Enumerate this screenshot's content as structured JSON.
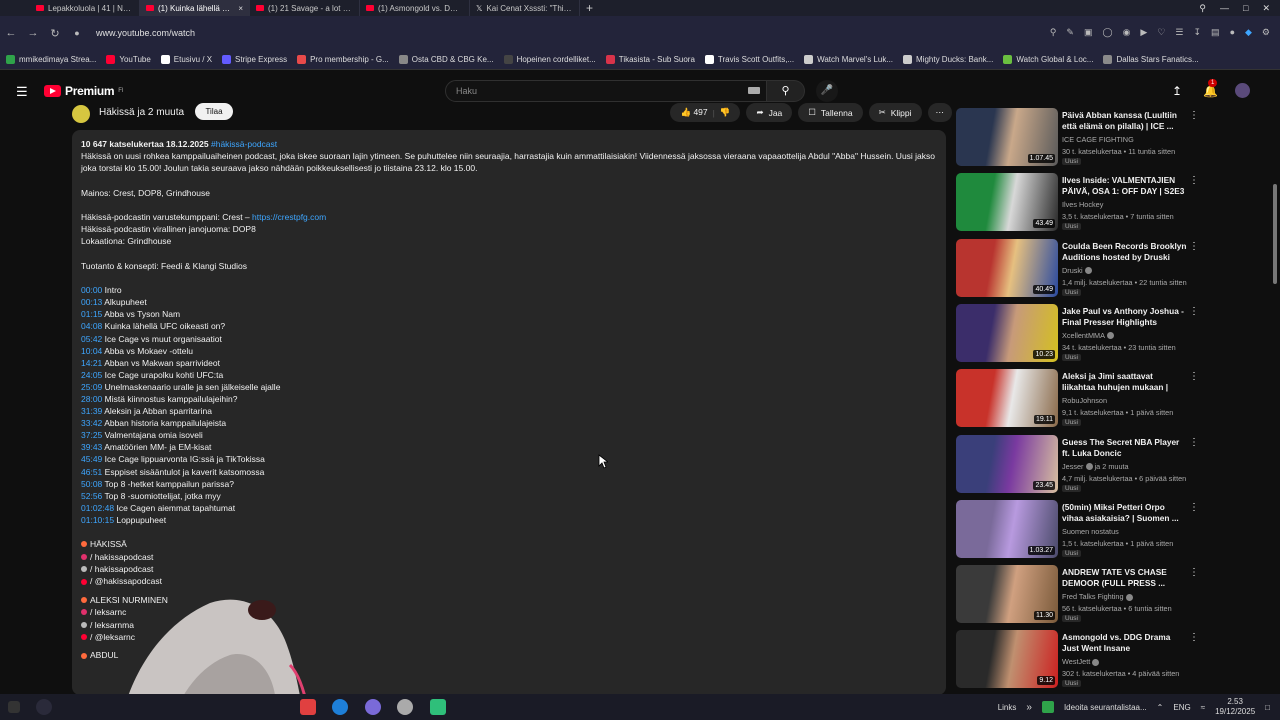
{
  "browser": {
    "tabs": [
      {
        "label": "Lepakkoluola | 41 | Nyrki...",
        "icon": "youtube",
        "active": false
      },
      {
        "label": "(1) Kuinka lähellä UFC oli...",
        "icon": "youtube",
        "active": true
      },
      {
        "label": "(1) 21 Savage - a lot (Offic...",
        "icon": "youtube",
        "active": false
      },
      {
        "label": "(1) Asmongold vs. DDG Dr...",
        "icon": "youtube",
        "active": false
      },
      {
        "label": "Kai Cenat Xsssti: \"This tool...",
        "icon": "x",
        "active": false
      }
    ],
    "url": "www.youtube.com/watch",
    "bookmarks": [
      {
        "label": "mmikedimaya Strea...",
        "color": "#2fa34a"
      },
      {
        "label": "YouTube",
        "color": "#ff0033"
      },
      {
        "label": "Etusivu / X",
        "color": "#ffffff"
      },
      {
        "label": "Stripe Express",
        "color": "#635bff"
      },
      {
        "label": "Pro membership - G...",
        "color": "#e84a4a"
      },
      {
        "label": "Osta CBD & CBG Ke...",
        "color": "#888888"
      },
      {
        "label": "Hopeinen cordelliket...",
        "color": "#444444"
      },
      {
        "label": "Tikasista - Sub Suora",
        "color": "#d8334a"
      },
      {
        "label": "Travis Scott Outfits,...",
        "color": "#ffffff"
      },
      {
        "label": "Watch Marvel's Luk...",
        "color": "#cccccc"
      },
      {
        "label": "Mighty Ducks: Bank...",
        "color": "#cccccc"
      },
      {
        "label": "Watch Global & Loc...",
        "color": "#6abf40"
      },
      {
        "label": "Dallas Stars Fanatics...",
        "color": "#8a8a8a"
      }
    ]
  },
  "youtube": {
    "logo_text": "Premium",
    "logo_sup": "FI",
    "search_placeholder": "Haku",
    "notification_count": "1"
  },
  "video": {
    "channel_name": "Häkissä ja 2 muuta",
    "subscribe_label": "Tilaa",
    "likes": "497",
    "share_label": "Jaa",
    "save_label": "Tallenna",
    "clip_label": "Klippi"
  },
  "description": {
    "views_date": "10 647 katselukertaa  18.12.2025",
    "hashtag": "#häkissä-podcast",
    "intro_1": "Häkissä on uusi rohkea kamppailuaiheinen podcast, joka iskee suoraan lajin ytimeen. Se puhuttelee niin seuraajia, harrastajia kuin ammattilaisiakin! Viidennessä jaksossa vieraana vapaaottelija Abdul \"Abba\" Hussein. Uusi jakso",
    "intro_2": "joka torstai klo 15.00! Joulun takia seuraava jakso nähdään poikkeuksellisesti jo tiistaina 23.12. klo 15.00.",
    "ads": "Mainos: Crest, DOP8, Grindhouse",
    "partner_prefix": "Häkissä-podcastin varustekumppani: Crest – ",
    "partner_link": "https://crestpfg.com",
    "drink": "Häkissä-podcastin virallinen janojuoma: DOP8",
    "location": "Lokaationa: Grindhouse",
    "production": "Tuotanto & konsepti: Feedi & Klangi Studios",
    "chapters": [
      {
        "ts": "00:00",
        "label": "Intro"
      },
      {
        "ts": "00:13",
        "label": "Alkupuheet"
      },
      {
        "ts": "01:15",
        "label": "Abba vs Tyson Nam"
      },
      {
        "ts": "04:08",
        "label": "Kuinka lähellä UFC oikeasti on?"
      },
      {
        "ts": "05:42",
        "label": "Ice Cage vs muut organisaatiot"
      },
      {
        "ts": "10:04",
        "label": "Abba vs Mokaev -ottelu"
      },
      {
        "ts": "14:21",
        "label": "Abban vs Makwan sparrivideot"
      },
      {
        "ts": "24:05",
        "label": "Ice Cage urapolku kohti UFC:ta"
      },
      {
        "ts": "25:09",
        "label": "Unelmaskenaario uralle ja sen jälkeiselle ajalle"
      },
      {
        "ts": "28:00",
        "label": "Mistä kiinnostus kamppailulajeihin?"
      },
      {
        "ts": "31:39",
        "label": "Aleksin ja Abban sparritarina"
      },
      {
        "ts": "33:42",
        "label": "Abban historia kamppailulajeista"
      },
      {
        "ts": "37:25",
        "label": "Valmentajana omia isoveli"
      },
      {
        "ts": "39:43",
        "label": "Amatöörien MM- ja EM-kisat"
      },
      {
        "ts": "45:49",
        "label": "Ice Cage lippuarvonta IG:ssä ja TikTokissa"
      },
      {
        "ts": "46:51",
        "label": "Esppiset sisääntulot ja kaverit katsomossa"
      },
      {
        "ts": "50:08",
        "label": "Top 8 -hetket kamppailun parissa?"
      },
      {
        "ts": "52:56",
        "label": "Top 8 -suomiottelijat, jotka myy"
      },
      {
        "ts": "01:02:48",
        "label": "Ice Cagen aiemmat tapahtumat"
      },
      {
        "ts": "01:10:15",
        "label": "Loppupuheet"
      }
    ],
    "hakissa_heading": "HÄKISSÄ",
    "hakissa_links": [
      {
        "text": "/ hakissapodcast",
        "color": "#e1306c"
      },
      {
        "text": "/ hakissapodcast",
        "color": "#bbbbbb"
      },
      {
        "text": "/ @hakissapodcast",
        "color": "#ff0033"
      }
    ],
    "aleksi_heading": "ALEKSI NURMINEN",
    "aleksi_links": [
      {
        "text": "/ leksarnc",
        "color": "#e1306c"
      },
      {
        "text": "/ leksarnma",
        "color": "#bbbbbb"
      },
      {
        "text": "/ @leksarnc",
        "color": "#ff0033"
      }
    ],
    "abdul_heading": "ABDUL"
  },
  "related": [
    {
      "title": "Päivä Abban kanssa (Luultiin että elämä on pilalla) | ICE ...",
      "channel": "ICE CAGE FIGHTING",
      "stats": "30 t. katselukertaa • 11 tuntia sitten",
      "duration": "1.07.45",
      "badge": "Uusi",
      "verified": false,
      "colors": [
        "#2a3650",
        "#c9a88a",
        "#5a5a5a"
      ]
    },
    {
      "title": "Ilves Inside: VALMENTAJIEN PÄIVÄ, OSA 1: OFF DAY | S2E3",
      "channel": "Ilves Hockey",
      "stats": "3,5 t. katselukertaa • 7 tuntia sitten",
      "duration": "43.49",
      "badge": "Uusi",
      "verified": false,
      "colors": [
        "#1f8a3d",
        "#d8d8d8",
        "#2a2a2a"
      ]
    },
    {
      "title": "Coulda Been Records Brooklyn Auditions hosted by Druski",
      "channel": "Druski",
      "stats": "1,4 milj. katselukertaa • 22 tuntia sitten",
      "duration": "40.49",
      "badge": "Uusi",
      "verified": true,
      "colors": [
        "#b8342f",
        "#e6c080",
        "#2a4aa0"
      ]
    },
    {
      "title": "Jake Paul vs Anthony Joshua - Final Presser Highlights",
      "channel": "XcellentMMA",
      "stats": "34 t. katselukertaa • 23 tuntia sitten",
      "duration": "10.23",
      "badge": "Uusi",
      "verified": true,
      "colors": [
        "#3b2d6a",
        "#c79a7a",
        "#d4c020"
      ]
    },
    {
      "title": "Aleksi ja Jimi saattavat liikahtaa huhujen mukaan | nat...",
      "channel": "RobuJohnson",
      "stats": "9,1 t. katselukertaa • 1 päivä sitten",
      "duration": "19.11",
      "badge": "Uusi",
      "verified": false,
      "colors": [
        "#c8322a",
        "#e8e8e8",
        "#8a6a4a"
      ]
    },
    {
      "title": "Guess The Secret NBA Player ft. Luka Doncic",
      "channel": "Jesser",
      "stats": "4,7 milj. katselukertaa • 6 päivää sitten",
      "duration": "23.45",
      "badge": "Uusi",
      "verified": true,
      "channel_suffix": "ja 2 muuta",
      "colors": [
        "#3a3f7a",
        "#7a3aa0",
        "#d8c0a0"
      ]
    },
    {
      "title": "(50min) Miksi Petteri Orpo vihaa asiakaisia? | Suomen ...",
      "channel": "Suomen nostatus",
      "stats": "1,5 t. katselukertaa • 1 päivä sitten",
      "duration": "1.03.27",
      "badge": "Uusi",
      "verified": false,
      "colors": [
        "#7a6a9a",
        "#b89adf",
        "#4a4a6a"
      ]
    },
    {
      "title": "ANDREW TATE VS CHASE DEMOOR (FULL PRESS ...",
      "channel": "Fred Talks Fighting",
      "stats": "56 t. katselukertaa • 6 tuntia sitten",
      "duration": "11.30",
      "badge": "Uusi",
      "verified": true,
      "colors": [
        "#3a3a3a",
        "#d0a080",
        "#7a5a3a"
      ]
    },
    {
      "title": "Asmongold vs. DDG Drama Just Went Insane",
      "channel": "WestJett",
      "stats": "302 t. katselukertaa • 4 päivää sitten",
      "duration": "9.12",
      "badge": "Uusi",
      "verified": true,
      "colors": [
        "#2a2a2a",
        "#c09070",
        "#cc2020"
      ]
    }
  ],
  "taskbar": {
    "links_label": "Links",
    "notification_text": "Ideoita seurantalistaa...",
    "language": "ENG",
    "time": "2.53",
    "date": "19/12/2025"
  }
}
